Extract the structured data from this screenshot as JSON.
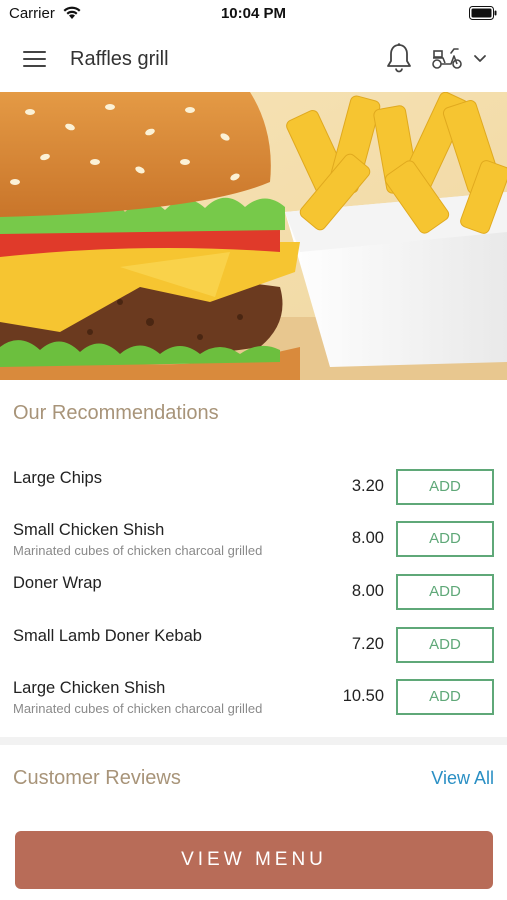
{
  "status_bar": {
    "carrier": "Carrier",
    "time": "10:04 PM"
  },
  "header": {
    "title": "Raffles grill",
    "icons": [
      "menu-icon",
      "bell-icon",
      "scooter-icon",
      "chevron-down-icon"
    ]
  },
  "hero": {
    "image": "burger-and-fries-photo"
  },
  "recommendations": {
    "title": "Our Recommendations",
    "items": [
      {
        "name": "Large Chips",
        "description": "",
        "price": "3.20",
        "button": "ADD"
      },
      {
        "name": "Small Chicken Shish",
        "description": "Marinated cubes of chicken charcoal grilled",
        "price": "8.00",
        "button": "ADD"
      },
      {
        "name": "Doner Wrap",
        "description": "",
        "price": "8.00",
        "button": "ADD"
      },
      {
        "name": "Small Lamb Doner Kebab",
        "description": "",
        "price": "7.20",
        "button": "ADD"
      },
      {
        "name": "Large Chicken Shish",
        "description": "Marinated cubes of chicken charcoal grilled",
        "price": "10.50",
        "button": "ADD"
      }
    ]
  },
  "reviews": {
    "title": "Customer Reviews",
    "view_all": "View All"
  },
  "footer": {
    "view_menu": "VIEW MENU"
  },
  "colors": {
    "accent_green": "#5fa878",
    "section_title": "#a89479",
    "link_blue": "#2a8fc4",
    "view_menu_bg": "#b86c58"
  }
}
